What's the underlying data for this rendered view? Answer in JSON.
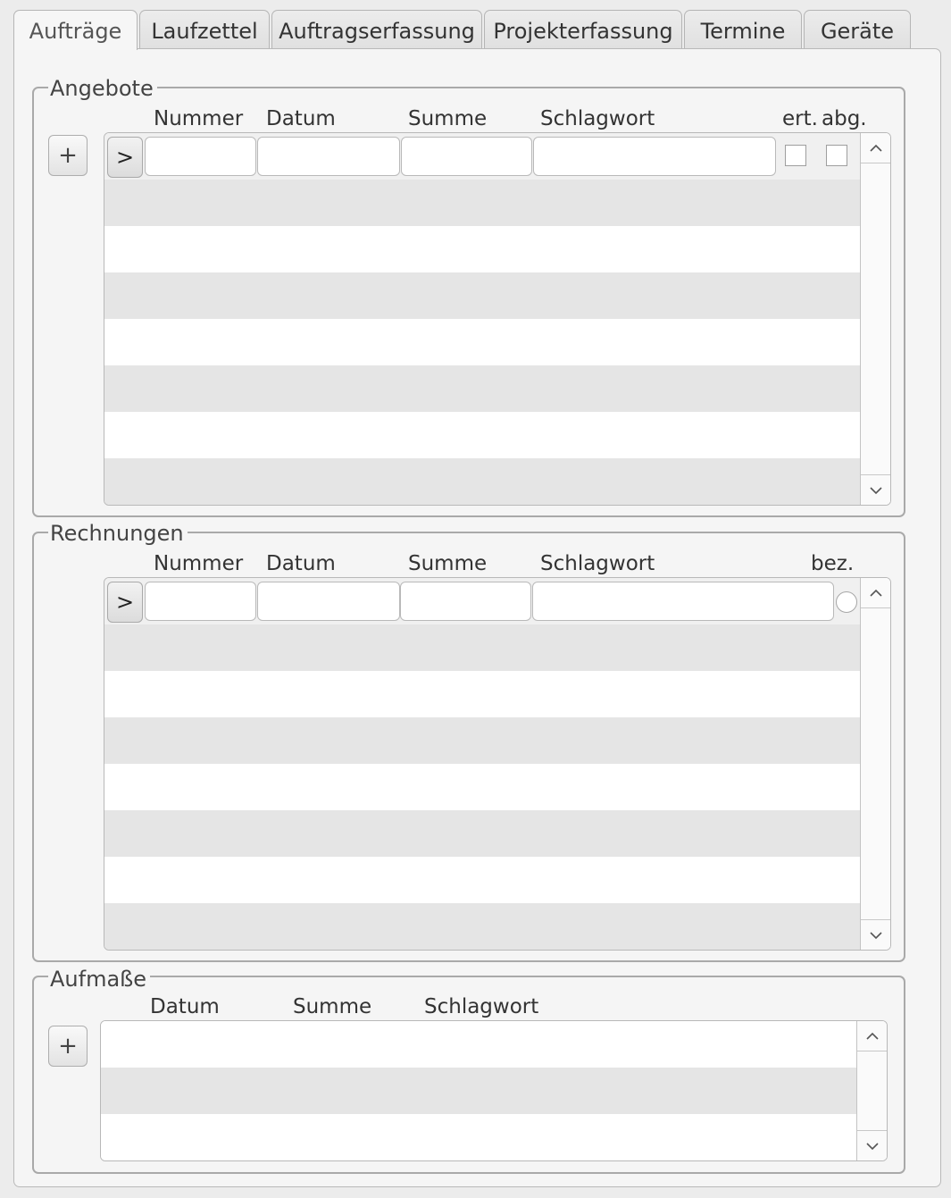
{
  "tabs": [
    {
      "label": "Aufträge",
      "active": true
    },
    {
      "label": "Laufzettel",
      "active": false
    },
    {
      "label": "Auftragserfassung",
      "active": false
    },
    {
      "label": "Projekterfassung",
      "active": false
    },
    {
      "label": "Termine",
      "active": false
    },
    {
      "label": "Geräte",
      "active": false
    }
  ],
  "angebote": {
    "title": "Angebote",
    "add_label": "+",
    "go_label": ">",
    "columns": {
      "nummer": "Nummer",
      "datum": "Datum",
      "summe": "Summe",
      "schlagwort": "Schlagwort",
      "ert": "ert.",
      "abg": "abg."
    },
    "filter": {
      "nummer": "",
      "datum": "",
      "summe": "",
      "schlagwort": "",
      "ert": false,
      "abg": false
    },
    "rows": []
  },
  "rechnungen": {
    "title": "Rechnungen",
    "go_label": ">",
    "columns": {
      "nummer": "Nummer",
      "datum": "Datum",
      "summe": "Summe",
      "schlagwort": "Schlagwort",
      "bez": "bez."
    },
    "filter": {
      "nummer": "",
      "datum": "",
      "summe": "",
      "schlagwort": "",
      "bez": false
    },
    "rows": []
  },
  "aufmasse": {
    "title": "Aufmaße",
    "add_label": "+",
    "columns": {
      "datum": "Datum",
      "summe": "Summe",
      "schlagwort": "Schlagwort"
    },
    "rows": []
  },
  "icons": {
    "scroll_up": "chevron-up-icon",
    "scroll_down": "chevron-down-icon"
  }
}
